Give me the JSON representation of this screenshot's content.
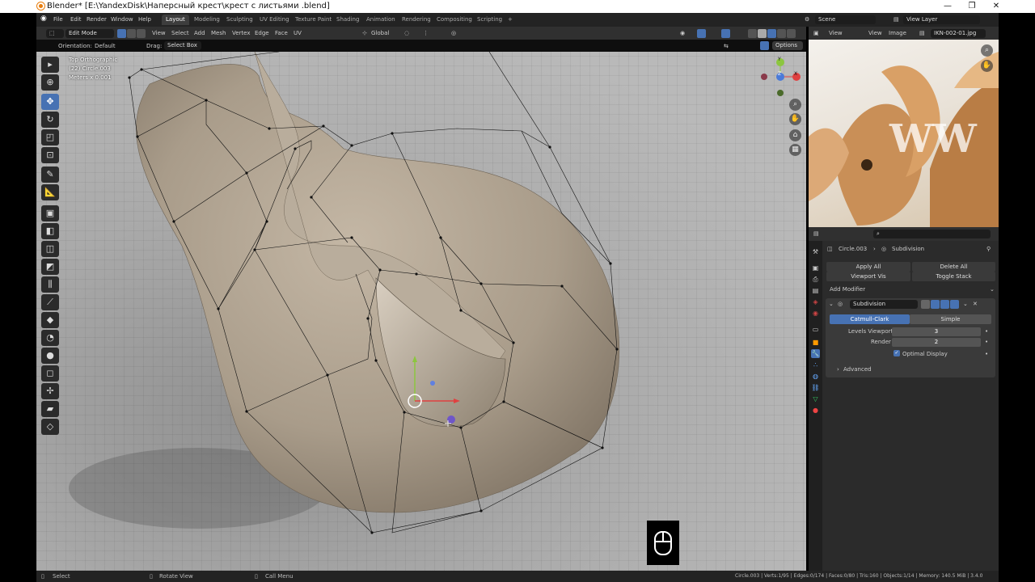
{
  "window": {
    "title": "Blender* [E:\\YandexDisk\\Наперсный крест\\крест с листьями .blend]",
    "controls": [
      "—",
      "❐",
      "✕"
    ]
  },
  "topbar": {
    "menus": [
      "File",
      "Edit",
      "Render",
      "Window",
      "Help"
    ],
    "workspaces": [
      "Layout",
      "Modeling",
      "Sculpting",
      "UV Editing",
      "Texture Paint",
      "Shading",
      "Animation",
      "Rendering",
      "Compositing",
      "Scripting",
      "+"
    ],
    "active_workspace": "Layout",
    "scene": "Scene",
    "view_layer": "View Layer"
  },
  "viewport_header": {
    "mode": "Edit Mode",
    "menus": [
      "View",
      "Select",
      "Add",
      "Mesh",
      "Vertex",
      "Edge",
      "Face",
      "UV"
    ],
    "transform_orientation": "Global",
    "options_label": "Options",
    "orientation_label": "Orientation:",
    "orientation_value": "Default",
    "drag_label": "Drag:",
    "drag_value": "Select Box"
  },
  "viewport_overlay": {
    "view_name": "Top Orthographic",
    "object_info": "(22) Circle.003",
    "units": "Meters x 0.001"
  },
  "gizmo": {
    "x": "X",
    "y": "Y",
    "z": "Z"
  },
  "toolbar": {
    "tools": [
      "select-icon",
      "cursor-icon",
      "move-icon",
      "rotate-icon",
      "scale-icon",
      "transform-icon",
      "annotate-icon",
      "measure-icon",
      "add-cube-icon",
      "extrude-icon",
      "inset-icon",
      "bevel-icon",
      "loop-cut-icon",
      "knife-icon",
      "poly-build-icon",
      "spin-icon",
      "smooth-icon",
      "edge-slide-icon",
      "shrink-icon",
      "shear-icon",
      "rip-icon"
    ],
    "active_tool": "move-icon"
  },
  "image_editor": {
    "menus": [
      "View",
      "View",
      "Image"
    ],
    "image_name": "IKN-002-01.jpg",
    "watermark": "WW"
  },
  "properties": {
    "breadcrumb_object": "Circle.003",
    "breadcrumb_modifier": "Subdivision",
    "apply_all": "Apply All",
    "delete_all": "Delete All",
    "viewport_vis": "Viewport Vis",
    "toggle_stack": "Toggle Stack",
    "add_modifier": "Add Modifier",
    "modifier_name": "Subdivision",
    "catmull_clark": "Catmull-Clark",
    "simple": "Simple",
    "levels_viewport_label": "Levels Viewport",
    "levels_viewport_value": "3",
    "render_label": "Render",
    "render_value": "2",
    "optimal_display": "Optimal Display",
    "advanced": "Advanced"
  },
  "statusbar": {
    "select": "Select",
    "rotate_view": "Rotate View",
    "call_menu": "Call Menu",
    "stats": "Circle.003 | Verts:1/95 | Edges:0/174 | Faces:0/80 | Tris:160 | Objects:1/14 | Memory: 140.5 MiB | 3.4.0"
  },
  "colors": {
    "accent": "#4772b3",
    "header": "#303030",
    "panel": "#2b2b2b",
    "mesh": "#b0a392"
  }
}
